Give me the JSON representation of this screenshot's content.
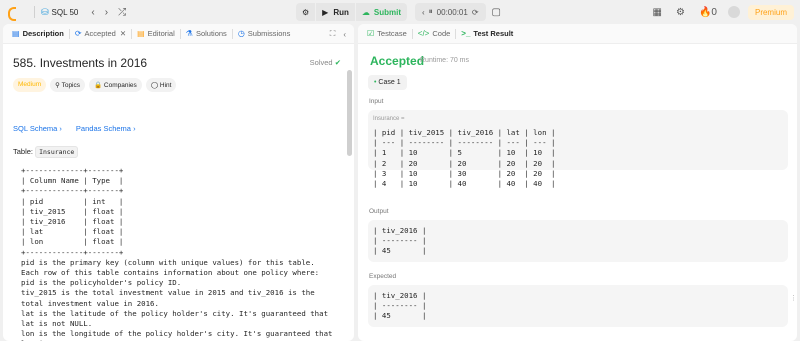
{
  "topbar": {
    "title": "SQL 50",
    "run_label": "Run",
    "submit_label": "Submit",
    "timer": "00:00:01",
    "streak": "0",
    "premium_label": "Premium"
  },
  "left_tabs": [
    {
      "label": "Description",
      "icon": "description-icon"
    },
    {
      "label": "Accepted",
      "icon": "history-icon"
    },
    {
      "label": "Editorial",
      "icon": "book-icon"
    },
    {
      "label": "Solutions",
      "icon": "flask-icon"
    },
    {
      "label": "Submissions",
      "icon": "clock-icon"
    }
  ],
  "problem": {
    "title": "585. Investments in 2016",
    "solved": "Solved",
    "chips": [
      "Medium",
      "Topics",
      "Companies",
      "Hint"
    ],
    "schemas": [
      "SQL Schema",
      "Pandas Schema"
    ],
    "table_prefix": "Table:",
    "table_name": "Insurance",
    "description": "+-------------+-------+\n| Column Name | Type  |\n+-------------+-------+\n| pid         | int   |\n| tiv_2015    | float |\n| tiv_2016    | float |\n| lat         | float |\n| lon         | float |\n+-------------+-------+\npid is the primary key (column with unique values) for this table.\nEach row of this table contains information about one policy where:\npid is the policyholder's policy ID.\ntiv_2015 is the total investment value in 2015 and tiv_2016 is the\ntotal investment value in 2016.\nlat is the latitude of the policy holder's city. It's guaranteed that\nlat is not NULL.\nlon is the longitude of the policy holder's city. It's guaranteed that\nlon is not NULL."
  },
  "right_tabs": [
    {
      "label": "Testcase",
      "icon": "check-box-icon"
    },
    {
      "label": "Code",
      "icon": "code-icon"
    },
    {
      "label": "Test Result",
      "icon": "terminal-icon"
    }
  ],
  "result": {
    "status": "Accepted",
    "runtime": "Runtime: 70 ms",
    "case_label": "Case 1",
    "input_label": "Input",
    "input_caption": "Insurance =",
    "input_table": "| pid | tiv_2015 | tiv_2016 | lat | lon |\n| --- | -------- | -------- | --- | --- |\n| 1   | 10       | 5        | 10  | 10  |\n| 2   | 20       | 20       | 20  | 20  |\n| 3   | 10       | 30       | 20  | 20  |\n| 4   | 10       | 40       | 40  | 40  |",
    "output_label": "Output",
    "output_table": "| tiv_2016 |\n| -------- |\n| 45       |",
    "expected_label": "Expected",
    "expected_table": "| tiv_2016 |\n| -------- |\n| 45       |"
  },
  "colors": {
    "accent": "#ffa116",
    "success": "#2db55d",
    "link": "#1a73e8"
  }
}
